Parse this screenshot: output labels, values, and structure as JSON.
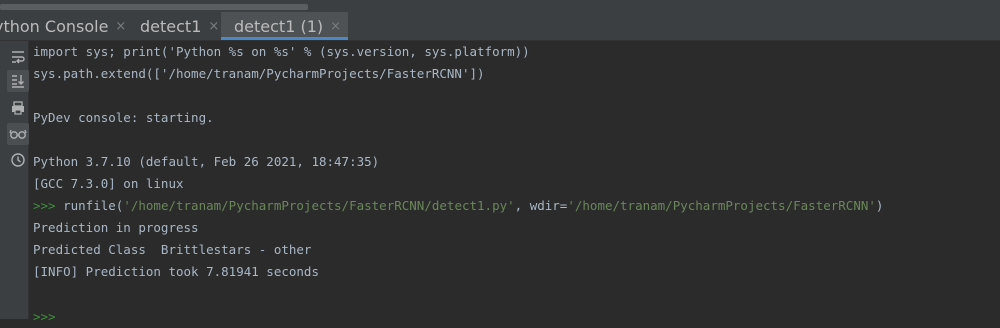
{
  "tabs": [
    {
      "label": "ython Console",
      "close": "×",
      "active": false
    },
    {
      "label": "detect1",
      "close": "×",
      "active": false
    },
    {
      "label": "detect1 (1)",
      "close": "×",
      "active": true
    }
  ],
  "toolbar": {
    "icons": [
      "soft-wrap-icon",
      "scroll-to-end-icon",
      "print-icon",
      "show-variables-icon",
      "history-icon"
    ]
  },
  "console": {
    "line1": "import sys; print('Python %s on %s' % (sys.version, sys.platform))",
    "line2": "sys.path.extend(['/home/tranam/PycharmProjects/FasterRCNN'])",
    "line3": "PyDev console: starting.",
    "line4": "Python 3.7.10 (default, Feb 26 2021, 18:47:35)",
    "line5": "[GCC 7.3.0] on linux",
    "cmd": {
      "prompt": ">>>",
      "fn": " runfile(",
      "arg1": "'/home/tranam/PycharmProjects/FasterRCNN/detect1.py'",
      "sep": ", wdir=",
      "arg2": "'/home/tranam/PycharmProjects/FasterRCNN'",
      "end": ")"
    },
    "line7": "Prediction in progress",
    "line8": "Predicted Class  Brittlestars - other",
    "line9": "[INFO] Prediction took 7.81941 seconds",
    "final_prompt": ">>>"
  },
  "colors": {
    "background": "#2b2b2b",
    "prompt": "#3d8f3d",
    "string": "#6a8759",
    "text": "#a9b7c6",
    "active_tab_underline": "#4a88c7"
  }
}
